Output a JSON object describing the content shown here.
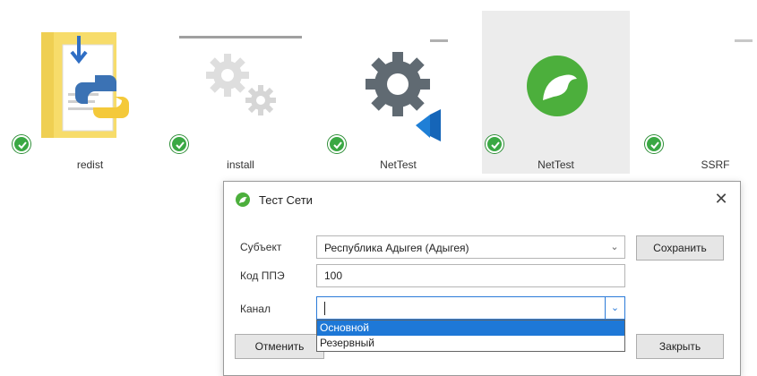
{
  "desktop": {
    "icons": [
      {
        "label": "redist",
        "icon": "python-folder-icon"
      },
      {
        "label": "install",
        "icon": "gears-icon"
      },
      {
        "label": "NetTest",
        "icon": "gear-vscode-icon"
      },
      {
        "label": "NetTest",
        "icon": "green-app-icon",
        "selected": true
      },
      {
        "label": "SSRF",
        "icon": "blank-file-icon"
      }
    ],
    "status_badge": "check-icon"
  },
  "dialog": {
    "title": "Тест Сети",
    "icon": "green-app-icon",
    "close": "✕",
    "subject_label": "Субъект",
    "subject_value": "Республика Адыгея (Адыгея)",
    "code_label": "Код ППЭ",
    "code_value": "100",
    "channel_label": "Канал",
    "channel_value": "",
    "channel_options": [
      "Основной",
      "Резервный"
    ],
    "highlighted_option": 0,
    "save_button": "Сохранить",
    "cancel_button": "Отменить",
    "close_button": "Закрыть"
  },
  "colors": {
    "accent": "#1e78d7",
    "ok_green": "#3aa843"
  }
}
